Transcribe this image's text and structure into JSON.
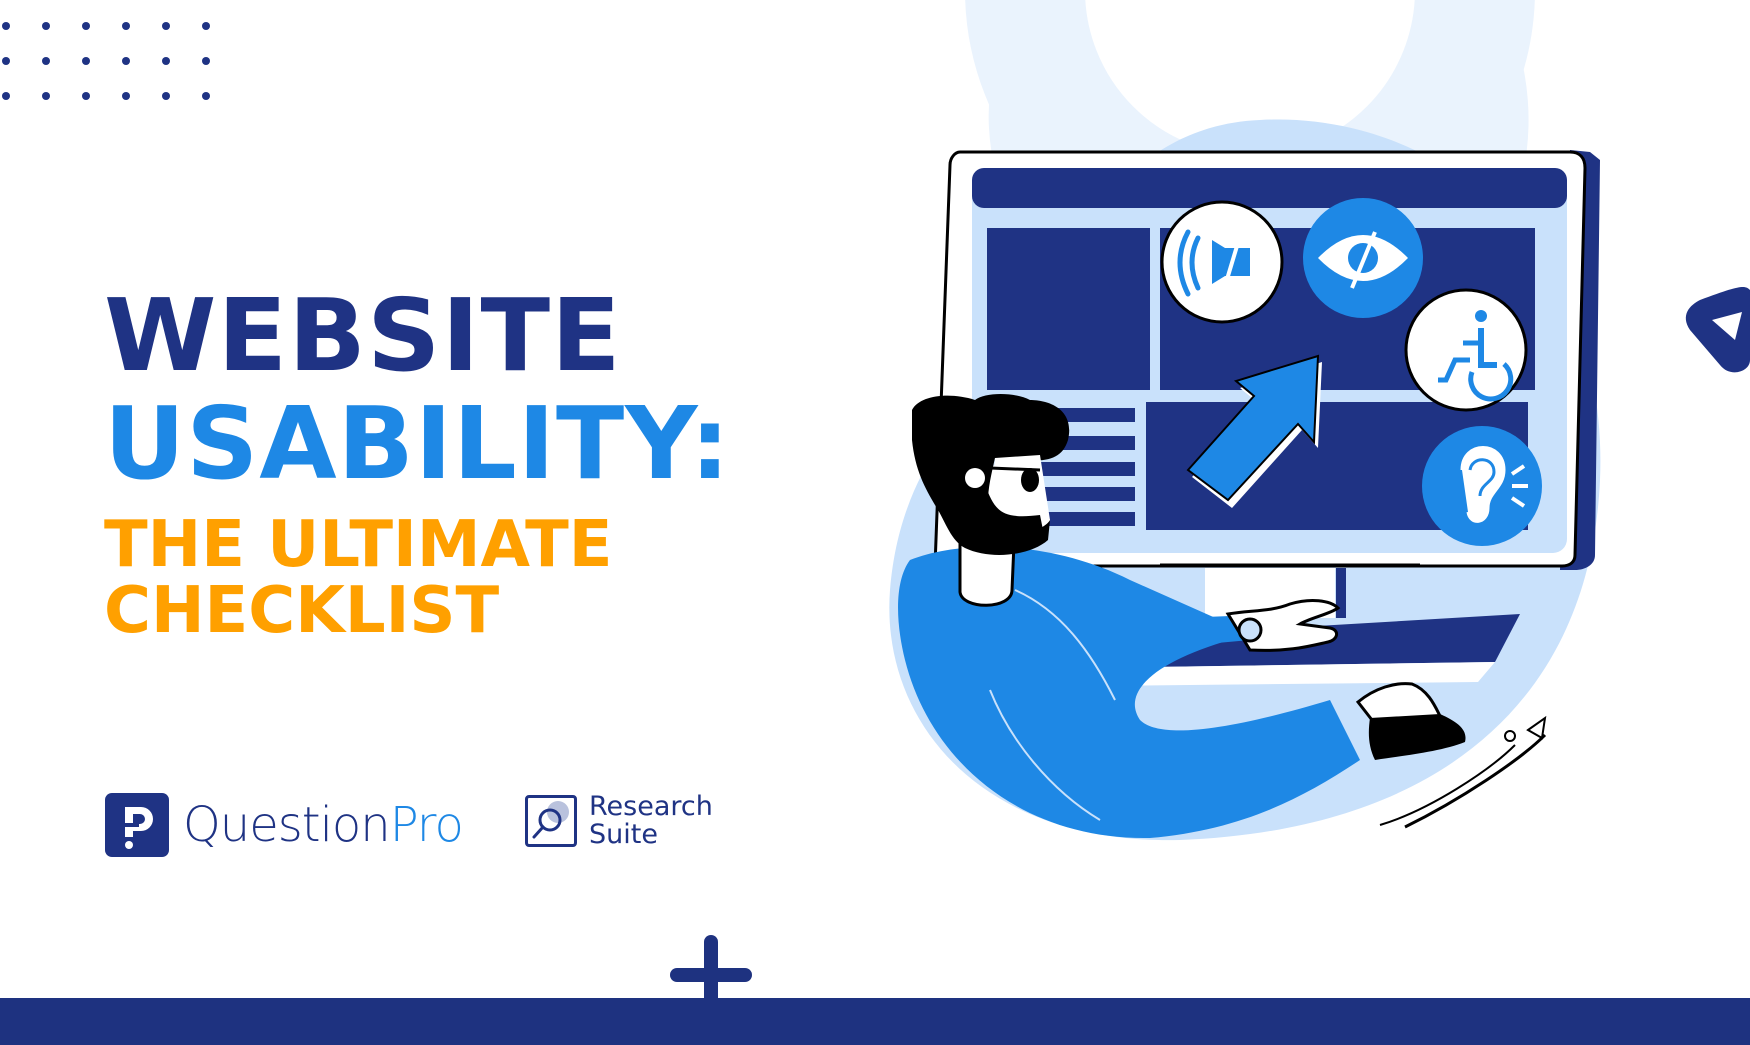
{
  "headline": {
    "line1": "WEBSITE",
    "line2": "USABILITY:",
    "subtitle_line1": "THE ULTIMATE",
    "subtitle_line2": "CHECKLIST"
  },
  "logos": {
    "questionpro": {
      "name_part1": "Question",
      "name_part2": "Pro"
    },
    "research_suite": {
      "line1": "Research",
      "line2": "Suite"
    }
  },
  "illustration": {
    "subject": "person at computer with accessibility icons",
    "icons": [
      "sound-muted-icon",
      "eye-hidden-icon",
      "wheelchair-icon",
      "ear-hearing-icon",
      "cursor-arrow-icon"
    ]
  },
  "colors": {
    "navy": "#1f3384",
    "blue": "#1e88e5",
    "orange": "#ffa000",
    "light_blue": "#c9e1fb",
    "pale_blue": "#eaf3fd"
  }
}
